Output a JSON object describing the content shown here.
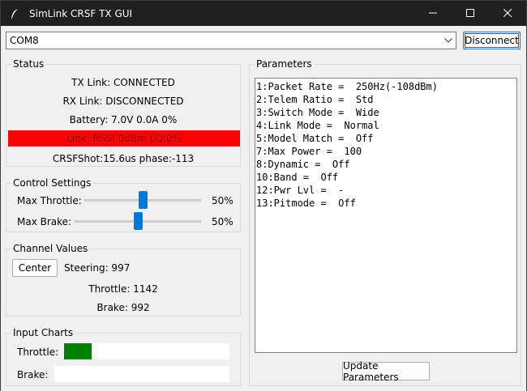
{
  "window": {
    "title": "SimLink CRSF TX GUI"
  },
  "toolbar": {
    "port_value": "COM8",
    "disconnect_label": "Disconnect"
  },
  "status": {
    "label": "Status",
    "tx_link": "TX Link: CONNECTED",
    "rx_link": "RX Link: DISCONNECTED",
    "battery": "Battery: 7.0V 0.0A 0%",
    "link": "Link: RSSI:0dBm LQ:0%",
    "crsf_shot": "CRSFShot:15.6us phase:-113",
    "link_bar_color": "#ff0000"
  },
  "control_settings": {
    "label": "Control Settings",
    "max_throttle_label": "Max Throttle:",
    "max_throttle_value": "50%",
    "max_throttle_level": 0.5,
    "max_brake_label": "Max Brake:",
    "max_brake_value": "50%",
    "max_brake_level": 0.5,
    "slider_color": "#0078d7"
  },
  "channel_values": {
    "label": "Channel Values",
    "center_button": "Center",
    "steering": "Steering: 997",
    "throttle": "Throttle: 1142",
    "brake": "Brake: 992"
  },
  "input_charts": {
    "label": "Input Charts",
    "throttle_label": "Throttle:",
    "throttle_level": 0.165,
    "brake_label": "Brake:",
    "brake_level": 0,
    "fill_color": "#008000"
  },
  "parameters": {
    "label": "Parameters",
    "lines": [
      "1:Packet Rate =  250Hz(-108dBm)",
      "2:Telem Ratio =  Std",
      "3:Switch Mode =  Wide",
      "4:Link Mode =  Normal",
      "5:Model Match =  Off",
      "7:Max Power =  100",
      "8:Dynamic =  Off",
      "10:Band =  Off",
      "12:Pwr Lvl =  -",
      "13:Pitmode =  Off"
    ],
    "update_button": "Update Parameters"
  },
  "icons": {
    "app": "feather-icon",
    "minimize": "minimize-icon",
    "maximize": "maximize-icon",
    "close": "close-icon",
    "dropdown": "chevron-down-icon"
  }
}
